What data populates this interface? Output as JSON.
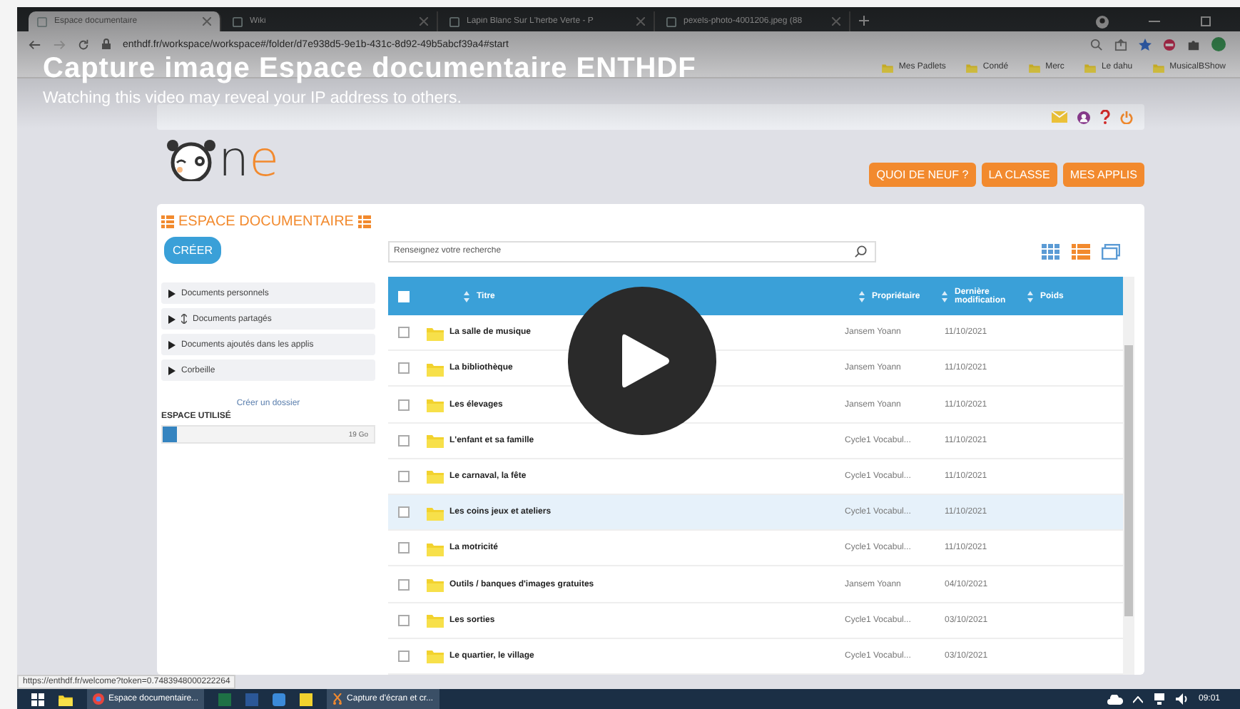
{
  "video": {
    "title": "Capture image Espace documentaire ENTHDF",
    "notice": "Watching this video may reveal your IP address to others."
  },
  "browser": {
    "tabs": [
      {
        "title": "Espace documentaire",
        "selected": true
      },
      {
        "title": "Wiki",
        "selected": false
      },
      {
        "title": "Lapin Blanc Sur L'herbe Verte - P",
        "selected": false
      },
      {
        "title": "pexels-photo-4001206.jpeg (88",
        "selected": false
      }
    ],
    "url": "enthdf.fr/workspace/workspace#/folder/d7e938d5-9e1b-431c-8d92-49b5abcf39a4#start",
    "bookmarks": [
      "Mes Padlets",
      "Condé",
      "Merc",
      "Le dahu",
      "MusicalBShow"
    ],
    "status_url": "https://enthdf.fr/welcome?token=0.7483948000222264"
  },
  "header": {
    "logo": [
      {
        "text": "n",
        "color": "#333333"
      },
      {
        "text": "e",
        "color": "#f28a2e"
      }
    ],
    "nav_buttons": [
      "QUOI DE NEUF ?",
      "LA CLASSE",
      "MES APPLIS"
    ]
  },
  "workspace": {
    "title": "ESPACE DOCUMENTAIRE",
    "create_button": "CRÉER",
    "search": {
      "placeholder": "Renseignez votre recherche"
    },
    "views": [
      {
        "kind": "grid",
        "selected": false
      },
      {
        "kind": "list",
        "selected": true
      },
      {
        "kind": "carousel",
        "selected": false
      }
    ],
    "sidebar": {
      "items": [
        {
          "label": "Documents personnels",
          "kind": "plain",
          "expanded": false
        },
        {
          "label": "Documents partagés",
          "kind": "shared",
          "expanded": false
        },
        {
          "label": "Documents ajoutés dans les applis",
          "kind": "plain",
          "expanded": false
        },
        {
          "label": "Corbeille",
          "kind": "plain",
          "expanded": false
        }
      ],
      "new_folder_link": "Créer un dossier",
      "space_label": "ESPACE UTILISÉ",
      "space": {
        "level": 0.07,
        "reading": "19 Go"
      }
    },
    "table": {
      "columns": [
        "Titre",
        "Propriétaire",
        "Dernière modification",
        "Poids"
      ],
      "all_checked": false,
      "rows": [
        {
          "title": "La salle de musique",
          "owner": "Jansem Yoann",
          "modified": "11/10/2021",
          "checked": false,
          "highlighted": false
        },
        {
          "title": "La bibliothèque",
          "owner": "Jansem Yoann",
          "modified": "11/10/2021",
          "checked": false,
          "highlighted": false
        },
        {
          "title": "Les élevages",
          "owner": "Jansem Yoann",
          "modified": "11/10/2021",
          "checked": false,
          "highlighted": false
        },
        {
          "title": "L'enfant et sa famille",
          "owner": "Cycle1 Vocabul...",
          "modified": "11/10/2021",
          "checked": false,
          "highlighted": false
        },
        {
          "title": "Le carnaval, la fête",
          "owner": "Cycle1 Vocabul...",
          "modified": "11/10/2021",
          "checked": false,
          "highlighted": false
        },
        {
          "title": "Les coins jeux et ateliers",
          "owner": "Cycle1 Vocabul...",
          "modified": "11/10/2021",
          "checked": false,
          "highlighted": true
        },
        {
          "title": "La motricité",
          "owner": "Cycle1 Vocabul...",
          "modified": "11/10/2021",
          "checked": false,
          "highlighted": false
        },
        {
          "title": "Outils / banques d'images gratuites",
          "owner": "Jansem Yoann",
          "modified": "04/10/2021",
          "checked": false,
          "highlighted": false
        },
        {
          "title": "Les sorties",
          "owner": "Cycle1 Vocabul...",
          "modified": "03/10/2021",
          "checked": false,
          "highlighted": false
        },
        {
          "title": "Le quartier, le village",
          "owner": "Cycle1 Vocabul...",
          "modified": "03/10/2021",
          "checked": false,
          "highlighted": false
        }
      ]
    }
  },
  "taskbar": {
    "apps": [
      {
        "label": "Espace documentaire...",
        "kind": "browser"
      },
      {
        "label": "Capture d'écran et cr...",
        "kind": "capture"
      }
    ],
    "time": "09:01"
  }
}
